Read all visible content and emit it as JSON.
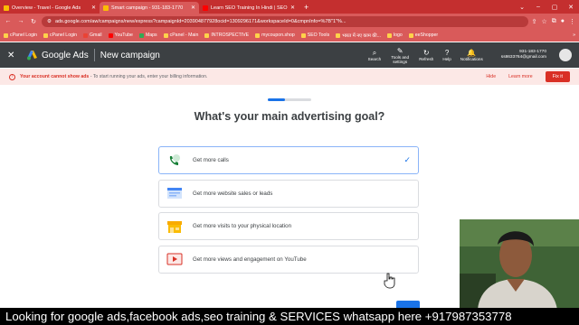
{
  "browser": {
    "tabs": [
      {
        "title": "Overview - Travel - Google Ads",
        "color": "#fbbc04"
      },
      {
        "title": "Smart campaign - 931-183-1770",
        "color": "#fbbc04"
      },
      {
        "title": "Learn SEO Training In Hindi | SEO",
        "color": "#ff0000"
      }
    ],
    "url": "ads.google.com/aw/campaigns/new/express?campaignId=203904877928ocid=1309296171&workspaceId=0&cmpnInfo=%7B\"1\"%...",
    "bookmarks": [
      "cPanel Login",
      "cPanel Login",
      "Gmail",
      "YouTube",
      "Maps",
      "cPanel - Main",
      "INTROSPECTIVE",
      "mycoupon.shop",
      "SEO Tools",
      "भारत में नए काम की...",
      "logo",
      "eeShopper"
    ]
  },
  "ads_header": {
    "product": "Google Ads",
    "page": "New campaign",
    "tools": [
      {
        "label": "Search",
        "icon": "search-icon",
        "glyph": "⌕"
      },
      {
        "label": "Tools and settings",
        "icon": "wrench-icon",
        "glyph": "✎"
      },
      {
        "label": "Refresh",
        "icon": "refresh-icon",
        "glyph": "↻"
      },
      {
        "label": "Help",
        "icon": "help-icon",
        "glyph": "?"
      },
      {
        "label": "Notifications",
        "icon": "bell-icon",
        "glyph": "🔔"
      }
    ],
    "account_id": "931-183-1770",
    "account_email": "ss8633764@gmail.com"
  },
  "alert": {
    "bold": "Your account cannot show ads",
    "text": " - To start running your ads, enter your billing information.",
    "hide": "Hide",
    "learn_more": "Learn more",
    "fix": "Fix it"
  },
  "main": {
    "progress": 0.4,
    "heading": "What's your main advertising goal?",
    "goals": [
      {
        "label": "Get more calls",
        "icon": "phone-icon",
        "selected": true
      },
      {
        "label": "Get more website sales or leads",
        "icon": "website-icon",
        "selected": false
      },
      {
        "label": "Get more visits to your physical location",
        "icon": "store-icon",
        "selected": false
      },
      {
        "label": "Get more views and engagement on YouTube",
        "icon": "youtube-icon",
        "selected": false
      }
    ]
  },
  "caption": "Looking for google ads,facebook ads,seo training & SERVICES whatsapp here +917987353778"
}
